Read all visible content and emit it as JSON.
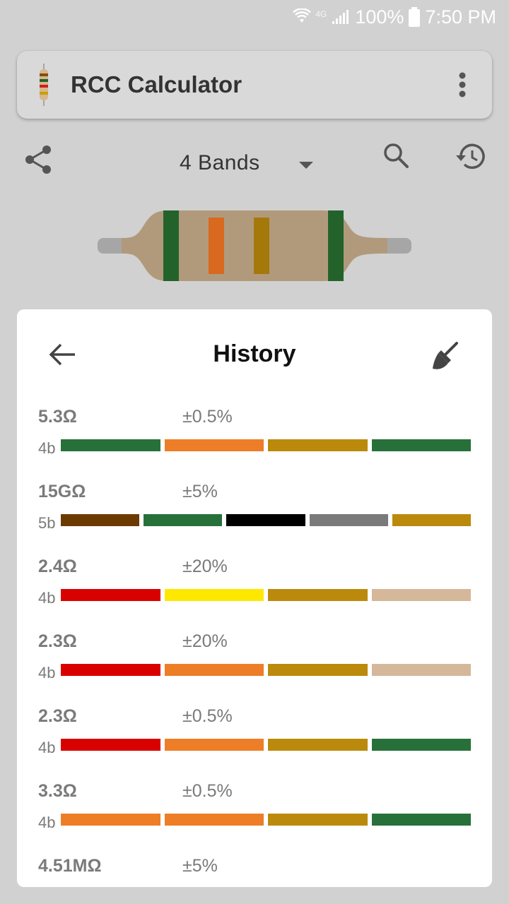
{
  "status_bar": {
    "battery": "100%",
    "time": "7:50 PM",
    "signal_label": "4G"
  },
  "toolbar": {
    "title": "RCC Calculator"
  },
  "actions": {
    "band_mode": "4 Bands"
  },
  "resistor_preview": {
    "band_colors": [
      "#23632b",
      "#d8691f",
      "#a5780a",
      "#23632b"
    ],
    "body_color": "#b19a7c",
    "lead_color": "#a6a6a6"
  },
  "history": {
    "title": "History",
    "entries": [
      {
        "value": "5.3Ω",
        "tolerance": "±0.5%",
        "bands_label": "4b",
        "colors": [
          "#28703a",
          "#ee7d28",
          "#bb8a0d",
          "#28703a"
        ]
      },
      {
        "value": "15GΩ",
        "tolerance": "±5%",
        "bands_label": "5b",
        "colors": [
          "#6b3a00",
          "#28703a",
          "#000000",
          "#7a7a7a",
          "#bb8a0d"
        ]
      },
      {
        "value": "2.4Ω",
        "tolerance": "±20%",
        "bands_label": "4b",
        "colors": [
          "#d90000",
          "#ffe800",
          "#bb8a0d",
          "#d5b79a"
        ]
      },
      {
        "value": "2.3Ω",
        "tolerance": "±20%",
        "bands_label": "4b",
        "colors": [
          "#d90000",
          "#ee7d28",
          "#bb8a0d",
          "#d5b79a"
        ]
      },
      {
        "value": "2.3Ω",
        "tolerance": "±0.5%",
        "bands_label": "4b",
        "colors": [
          "#d90000",
          "#ee7d28",
          "#bb8a0d",
          "#28703a"
        ]
      },
      {
        "value": "3.3Ω",
        "tolerance": "±0.5%",
        "bands_label": "4b",
        "colors": [
          "#ee7d28",
          "#ee7d28",
          "#bb8a0d",
          "#28703a"
        ]
      },
      {
        "value": "4.51MΩ",
        "tolerance": "±5%",
        "bands_label": "",
        "colors": []
      }
    ]
  }
}
